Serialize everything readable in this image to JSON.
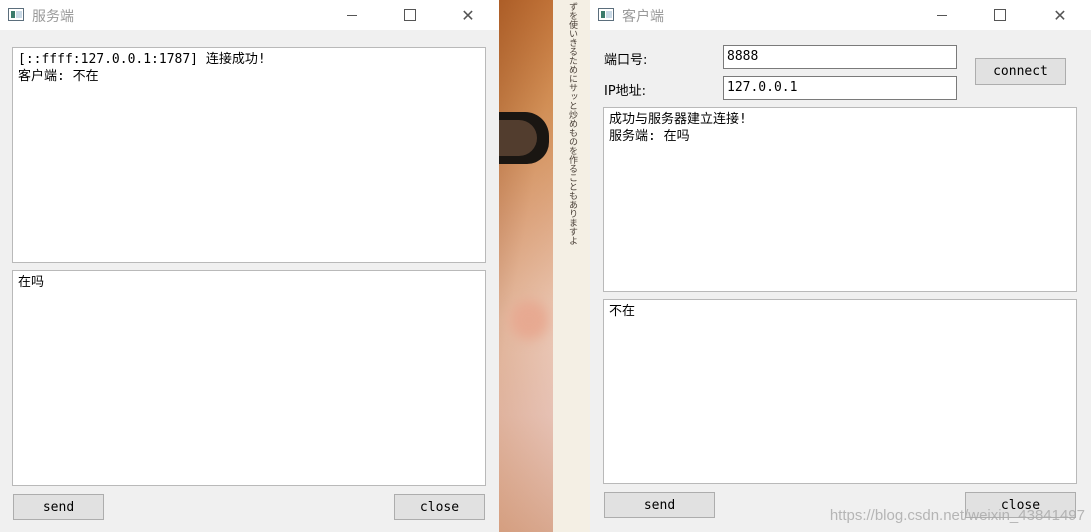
{
  "server": {
    "title": "服务端",
    "log_text": "[::ffff:127.0.0.1:1787] 连接成功!\n客户端: 不在",
    "input_text": "在吗",
    "send_label": "send",
    "close_label": "close"
  },
  "client": {
    "title": "客户端",
    "port_label": "端口号:",
    "port_value": "8888",
    "ip_label": "IP地址:",
    "ip_value": "127.0.0.1",
    "connect_label": "connect",
    "log_text": "成功与服务器建立连接!\n服务端: 在吗",
    "input_text": "不在",
    "send_label": "send",
    "close_label": "close"
  },
  "background": {
    "vertical_text": "ずを使いきるためにサッと炒めものを作ることもありますよ"
  },
  "watermark": "https://blog.csdn.net/weixin_43841497",
  "icons": {
    "app": "app-window-icon",
    "minimize": "minimize-icon",
    "maximize": "maximize-icon",
    "close": "close-icon"
  }
}
